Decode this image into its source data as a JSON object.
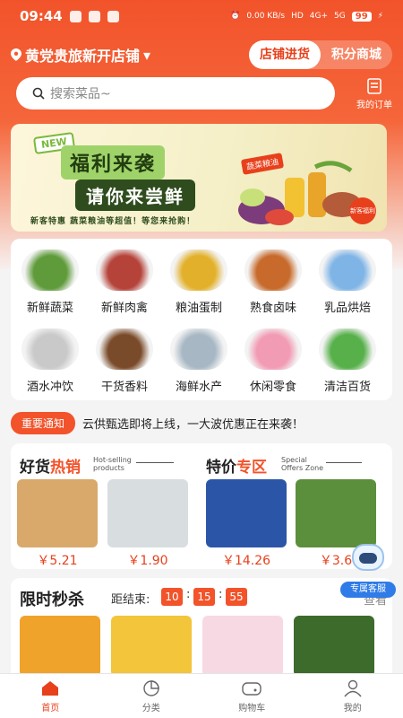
{
  "status": {
    "time": "09:44",
    "speed": "0.00 KB/s",
    "hd": "HD",
    "net1": "4G+",
    "net2": "5G",
    "battery": "99"
  },
  "header": {
    "store_name": "黄党贵旅新开店铺",
    "tabs": [
      {
        "label": "店铺进货",
        "active": true
      },
      {
        "label": "积分商城",
        "active": false
      }
    ]
  },
  "search": {
    "placeholder": "搜索菜品~"
  },
  "orders": {
    "label": "我的订单"
  },
  "banner": {
    "new": "NEW",
    "line1": "福利来袭",
    "line2": "请你来尝鲜",
    "line3": "新客特惠  蔬菜粮油等超值！等您来抢购！",
    "tag": "蔬菜粮油",
    "badge": "新客福利"
  },
  "categories": [
    {
      "label": "新鲜蔬菜",
      "color": "#5f9b3a"
    },
    {
      "label": "新鲜肉禽",
      "color": "#b5433a"
    },
    {
      "label": "粮油蛋制",
      "color": "#e2b02a"
    },
    {
      "label": "熟食卤味",
      "color": "#c76a2b"
    },
    {
      "label": "乳品烘焙",
      "color": "#7fb4e6"
    },
    {
      "label": "酒水冲饮",
      "color": "#c9c9c9"
    },
    {
      "label": "干货香料",
      "color": "#7a4b2a"
    },
    {
      "label": "海鲜水产",
      "color": "#a7b8c4"
    },
    {
      "label": "休闲零食",
      "color": "#f29bb4"
    },
    {
      "label": "清洁百货",
      "color": "#57b04a"
    }
  ],
  "notice": {
    "pill": "重要通知",
    "text": "云供甄选即将上线，一大波优惠正在来袭！"
  },
  "hot": {
    "title_a": "好货",
    "title_b": "热销",
    "en_a": "Hot-selling",
    "en_b": "products",
    "products": [
      {
        "price": "￥5.21",
        "color": "#d9a86b"
      },
      {
        "price": "￥1.90",
        "color": "#d8dde0"
      }
    ]
  },
  "special": {
    "title_a": "特价",
    "title_b": "专区",
    "en_a": "Special",
    "en_b": "Offers Zone",
    "products": [
      {
        "price": "￥14.26",
        "color": "#2b56a8"
      },
      {
        "price": "￥3.6",
        "color": "#5c8f3c"
      }
    ]
  },
  "flash": {
    "title": "限时秒杀",
    "ends_label": "距结束:",
    "h": "10",
    "m": "15",
    "s": "55",
    "more": "查看",
    "items": [
      {
        "color": "#f0a32a"
      },
      {
        "color": "#f2c53a"
      },
      {
        "color": "#f7d9e4"
      },
      {
        "color": "#3d6b2c"
      }
    ]
  },
  "service": {
    "label": "专属客服"
  },
  "tabbar": [
    {
      "label": "首页",
      "active": true
    },
    {
      "label": "分类",
      "active": false
    },
    {
      "label": "购物车",
      "active": false
    },
    {
      "label": "我的",
      "active": false
    }
  ],
  "colors": {
    "brand": "#f2532b",
    "accent_text": "#e8401c"
  }
}
